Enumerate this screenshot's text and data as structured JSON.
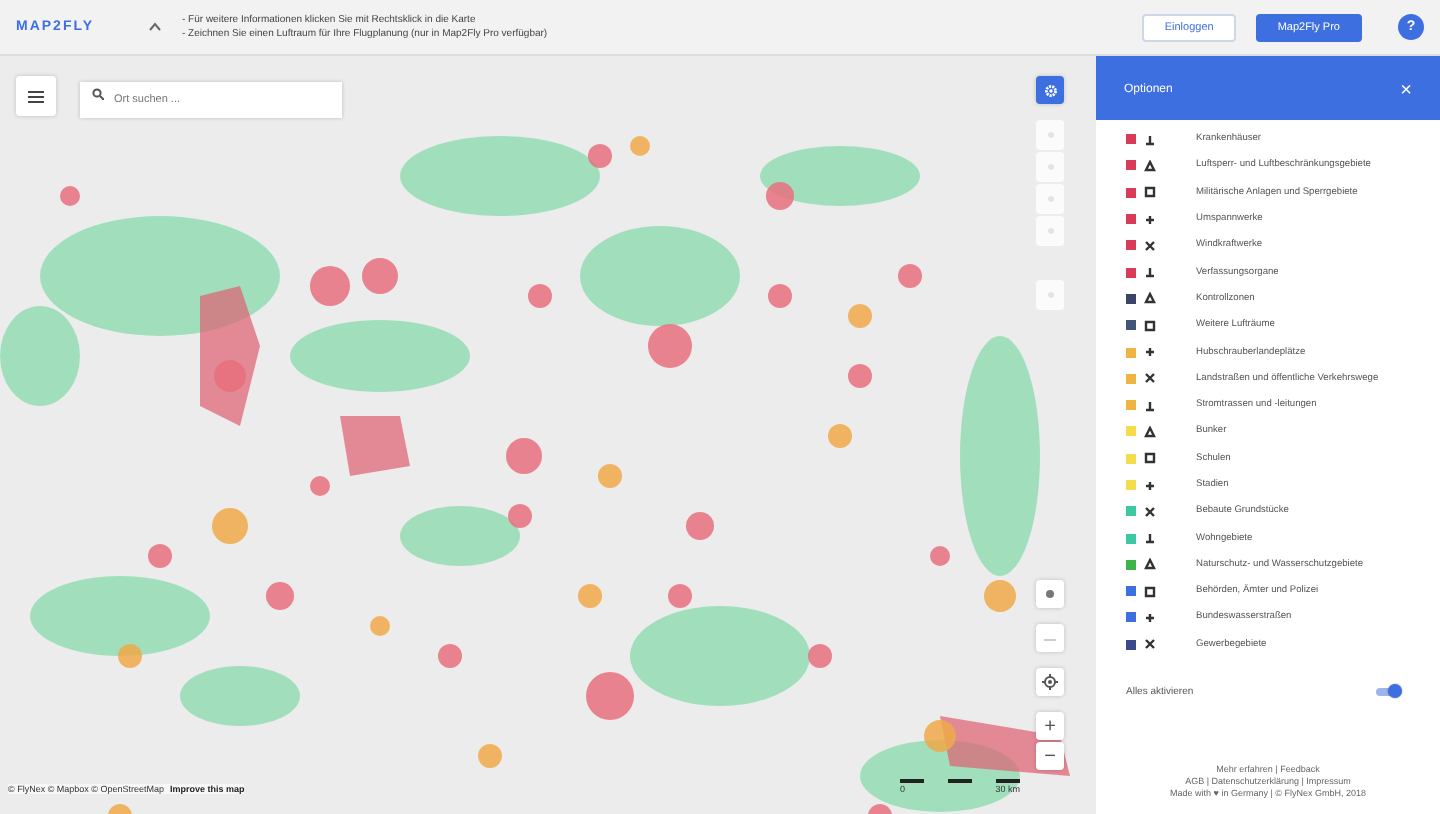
{
  "header": {
    "logo": "MAP2FLY",
    "hints": [
      "- Für weitere Informationen klicken Sie mit Rechtsklick in die Karte",
      "- Zeichnen Sie einen Luftraum für Ihre Flugplanung (nur in Map2Fly Pro verfügbar)"
    ],
    "login": "Einloggen",
    "pro": "Map2Fly Pro",
    "help": "?"
  },
  "map": {
    "search": {
      "placeholder": "Ort suchen ..."
    },
    "attribution": "© FlyNex © Mapbox © OpenStreetMap",
    "improve": "Improve this map",
    "scale": [
      "0",
      "30 km"
    ],
    "zoom_in": "+",
    "zoom_out": "−"
  },
  "panel": {
    "title": "Optionen",
    "close": "×",
    "layers": [
      {
        "label": "Krankenhäuser",
        "color": "#d83a5a"
      },
      {
        "label": "Luftsperr- und Luftbeschränkungsgebiete",
        "color": "#d83a5a"
      },
      {
        "label": "Militärische Anlagen und Sperrgebiete",
        "color": "#d83a5a"
      },
      {
        "label": "Umspannwerke",
        "color": "#d83a5a"
      },
      {
        "label": "Windkraftwerke",
        "color": "#d83a5a"
      },
      {
        "label": "Verfassungsorgane",
        "color": "#d83a5a"
      },
      {
        "label": "Kontrollzonen",
        "color": "#3b4566"
      },
      {
        "label": "Weitere Lufträume",
        "color": "#44557a"
      },
      {
        "label": "Hubschrauberlandeplätze",
        "color": "#f0b443"
      },
      {
        "label": "Landstraßen und öffentliche Verkehrswege",
        "color": "#f0b443"
      },
      {
        "label": "Stromtrassen und -leitungen",
        "color": "#f0b443"
      },
      {
        "label": "Bunker",
        "color": "#f4dc4e"
      },
      {
        "label": "Schulen",
        "color": "#f4dc4e"
      },
      {
        "label": "Stadien",
        "color": "#f4dc4e"
      },
      {
        "label": "Bebaute Grundstücke",
        "color": "#3cc9a2"
      },
      {
        "label": "Wohngebiete",
        "color": "#3cc9a2"
      },
      {
        "label": "Naturschutz- und Wasserschutzgebiete",
        "color": "#3bb54a"
      },
      {
        "label": "Behörden, Ämter und Polizei",
        "color": "#3d6fe0"
      },
      {
        "label": "Bundeswasserstraßen",
        "color": "#3d6fe0"
      },
      {
        "label": "Gewerbegebiete",
        "color": "#3c4a8c"
      }
    ],
    "all": {
      "label": "Alles aktivieren",
      "on": true
    },
    "footer": [
      "Mehr erfahren | Feedback",
      "AGB | Datenschutzerklärung | Impressum",
      "Made with ♥ in Germany | © FlyNex GmbH, 2018"
    ]
  }
}
